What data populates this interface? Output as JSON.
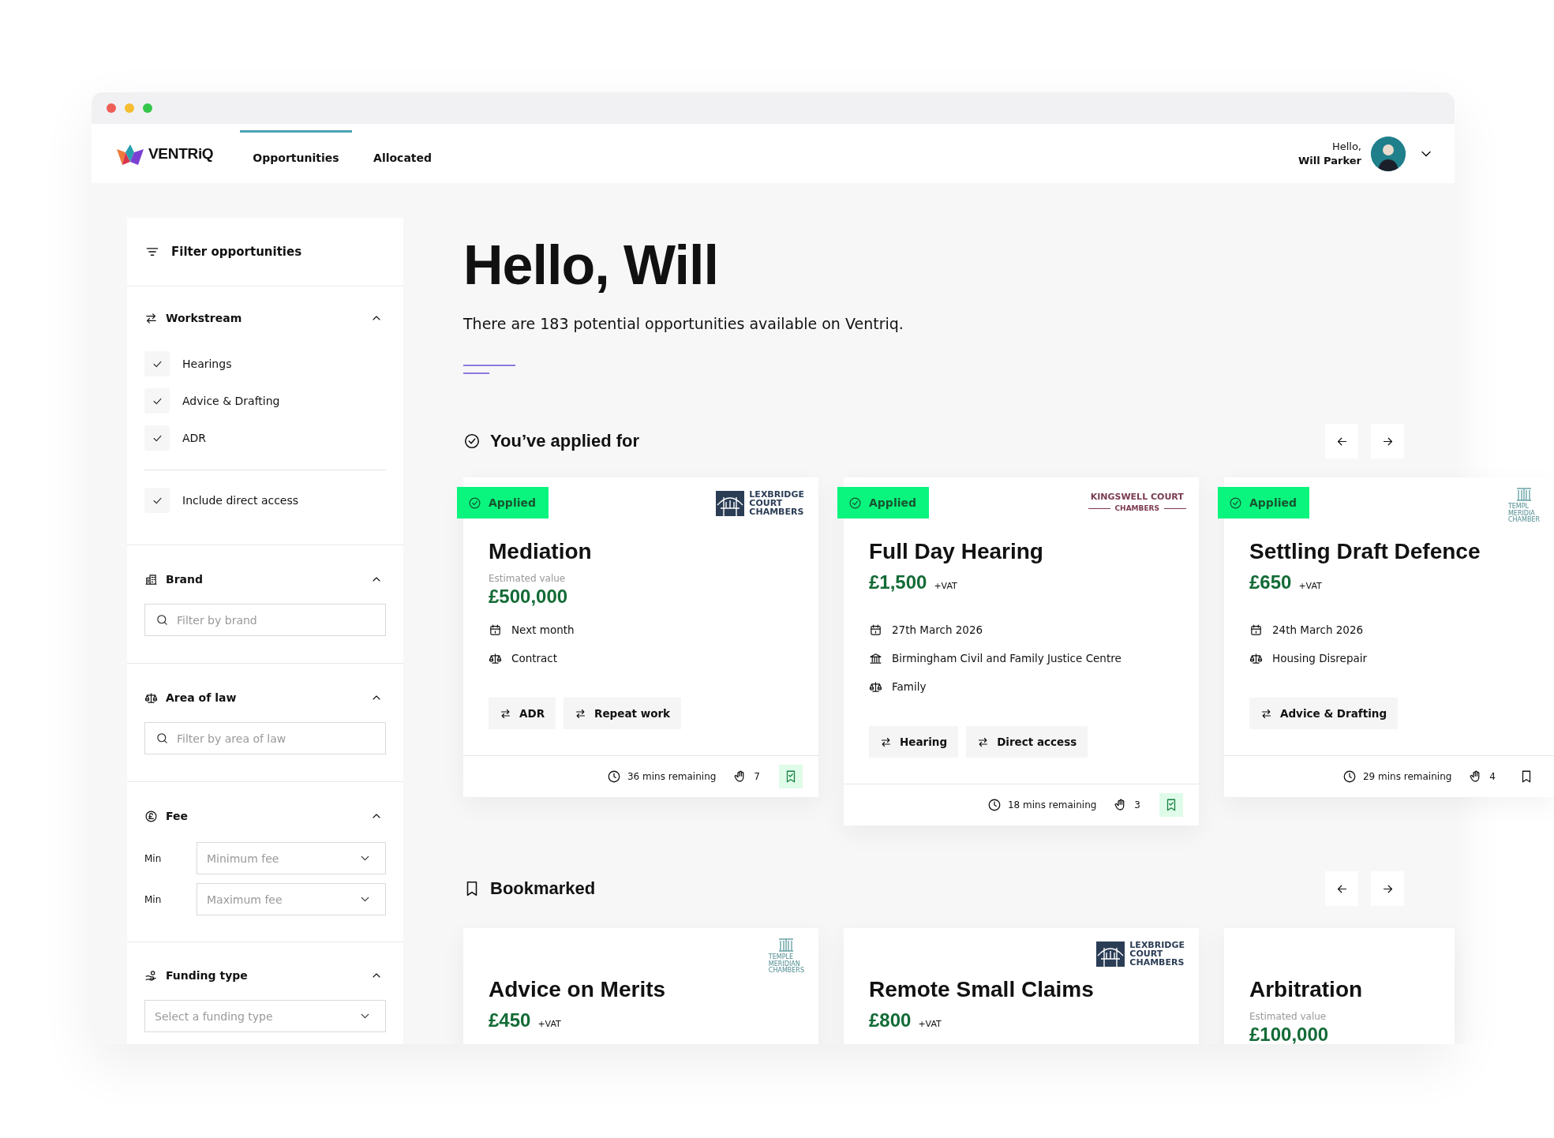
{
  "nav": {
    "logo": "VENTRiQ",
    "tabs": [
      {
        "label": "Opportunities",
        "selected": true
      },
      {
        "label": "Allocated",
        "selected": false
      }
    ],
    "user": {
      "greeting": "Hello,",
      "name": "Will Parker"
    }
  },
  "sidebar": {
    "title": "Filter opportunities",
    "sections": [
      {
        "kind": "checks",
        "title": "Workstream",
        "expanded": true,
        "options": [
          {
            "label": "Hearings",
            "checked": true
          },
          {
            "label": "Advice & Drafting",
            "checked": true
          },
          {
            "label": "ADR",
            "checked": true
          }
        ],
        "extra_options": [
          {
            "label": "Include direct access",
            "checked": true
          }
        ]
      },
      {
        "kind": "search",
        "title": "Brand",
        "expanded": true,
        "placeholder": "Filter by brand"
      },
      {
        "kind": "search",
        "title": "Area of law",
        "expanded": true,
        "placeholder": "Filter by area of law"
      },
      {
        "kind": "range",
        "title": "Fee",
        "expanded": true,
        "fields": [
          {
            "label": "Min",
            "placeholder": "Minimum fee"
          },
          {
            "label": "Min",
            "placeholder": "Maximum fee"
          }
        ]
      },
      {
        "kind": "select",
        "title": "Funding type",
        "expanded": true,
        "placeholder": "Select a funding type"
      }
    ]
  },
  "main": {
    "greeting": "Hello, Will",
    "subtitle": "There are 183 potential opportunities available on Ventriq.",
    "sections": [
      {
        "kind": "applied",
        "title": "You’ve applied for",
        "cards": [
          {
            "status": "Applied",
            "brand": {
              "kind": "lexbridge",
              "lines": [
                "LEXBRIDGE",
                "COURT",
                "CHAMBERS"
              ]
            },
            "title": "Mediation",
            "value_label": "Estimated value",
            "price": "£500,000",
            "details": [
              {
                "kind": "date",
                "text": "Next month"
              },
              {
                "kind": "law",
                "text": "Contract"
              }
            ],
            "tags": [
              "ADR",
              "Repeat work"
            ],
            "footer": {
              "remaining": "36 mins remaining",
              "count": "7",
              "bookmarked": true
            }
          },
          {
            "status": "Applied",
            "brand": {
              "kind": "kingswell",
              "lines": [
                "KINGSWELL COURT",
                "CHAMBERS"
              ]
            },
            "title": "Full Day Hearing",
            "price": "£1,500",
            "vat": "+VAT",
            "details": [
              {
                "kind": "date",
                "text": "27th March 2026"
              },
              {
                "kind": "venue",
                "text": "Birmingham Civil and Family Justice Centre"
              },
              {
                "kind": "law",
                "text": "Family"
              }
            ],
            "tags": [
              "Hearing",
              "Direct access"
            ],
            "footer": {
              "remaining": "18 mins remaining",
              "count": "3",
              "bookmarked": true
            }
          },
          {
            "status": "Applied",
            "brand": {
              "kind": "temple",
              "lines": [
                "TEMPL",
                "MERIDIA",
                "CHAMBER"
              ]
            },
            "title": "Settling Draft Defence",
            "price": "£650",
            "vat": "+VAT",
            "details": [
              {
                "kind": "date",
                "text": "24th March 2026"
              },
              {
                "kind": "law",
                "text": "Housing Disrepair"
              }
            ],
            "tags": [
              "Advice & Drafting"
            ],
            "footer": {
              "remaining": "29 mins remaining",
              "count": "4",
              "bookmarked": false
            }
          }
        ]
      },
      {
        "kind": "bookmarked",
        "title": "Bookmarked",
        "cards": [
          {
            "brand": {
              "kind": "temple",
              "lines": [
                "TEMPLE",
                "MERIDIAN",
                "CHAMBERS"
              ]
            },
            "title": "Advice on Merits",
            "price": "£450",
            "vat": "+VAT"
          },
          {
            "brand": {
              "kind": "lexbridge",
              "lines": [
                "LEXBRIDGE",
                "COURT",
                "CHAMBERS"
              ]
            },
            "title": "Remote Small Claims",
            "price": "£800",
            "vat": "+VAT"
          },
          {
            "title": "Arbitration",
            "value_label": "Estimated value",
            "price": "£100,000"
          }
        ]
      }
    ]
  }
}
